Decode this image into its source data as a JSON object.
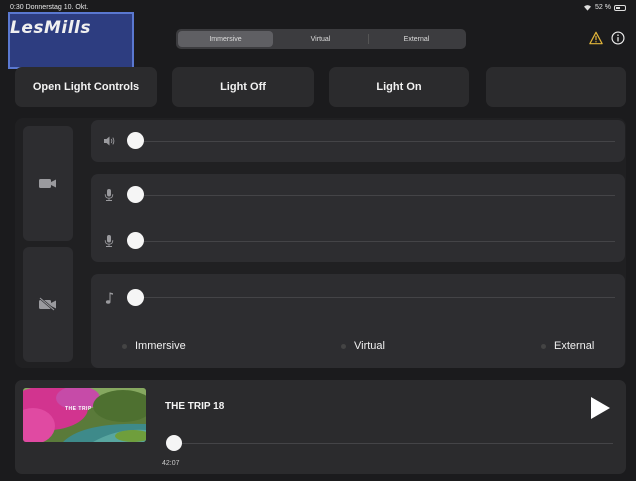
{
  "status_bar": {
    "time_date": "0:30 Donnerstag 10. Okt.",
    "battery": "52 %",
    "battery_level": 0.52
  },
  "header": {
    "logo_text": "LesMills",
    "tabs": [
      "Immersive",
      "Virtual",
      "External"
    ],
    "active_tab": 0
  },
  "controls": [
    "Open Light Controls",
    "Light Off",
    "Light On",
    ""
  ],
  "mixer": {
    "icons": {
      "camera_on": "video-camera-icon",
      "camera_off": "video-camera-off-icon",
      "volume": "speaker-icon",
      "mic_1": "microphone-icon",
      "mic_2": "microphone-icon",
      "music": "music-note-icon"
    },
    "levels": {
      "volume": 0,
      "mic_1": 0,
      "mic_2": 0,
      "music": 0
    },
    "source_options": [
      "Immersive",
      "Virtual",
      "External"
    ]
  },
  "player": {
    "title": "THE TRIP 18",
    "thumbnail_label": "THE TRIP",
    "time": "42:07",
    "progress": 0,
    "play_icon": "play-icon"
  },
  "colors": {
    "background": "#1b1b1d",
    "card": "#2d2d30",
    "warning": "#e2b53a"
  }
}
